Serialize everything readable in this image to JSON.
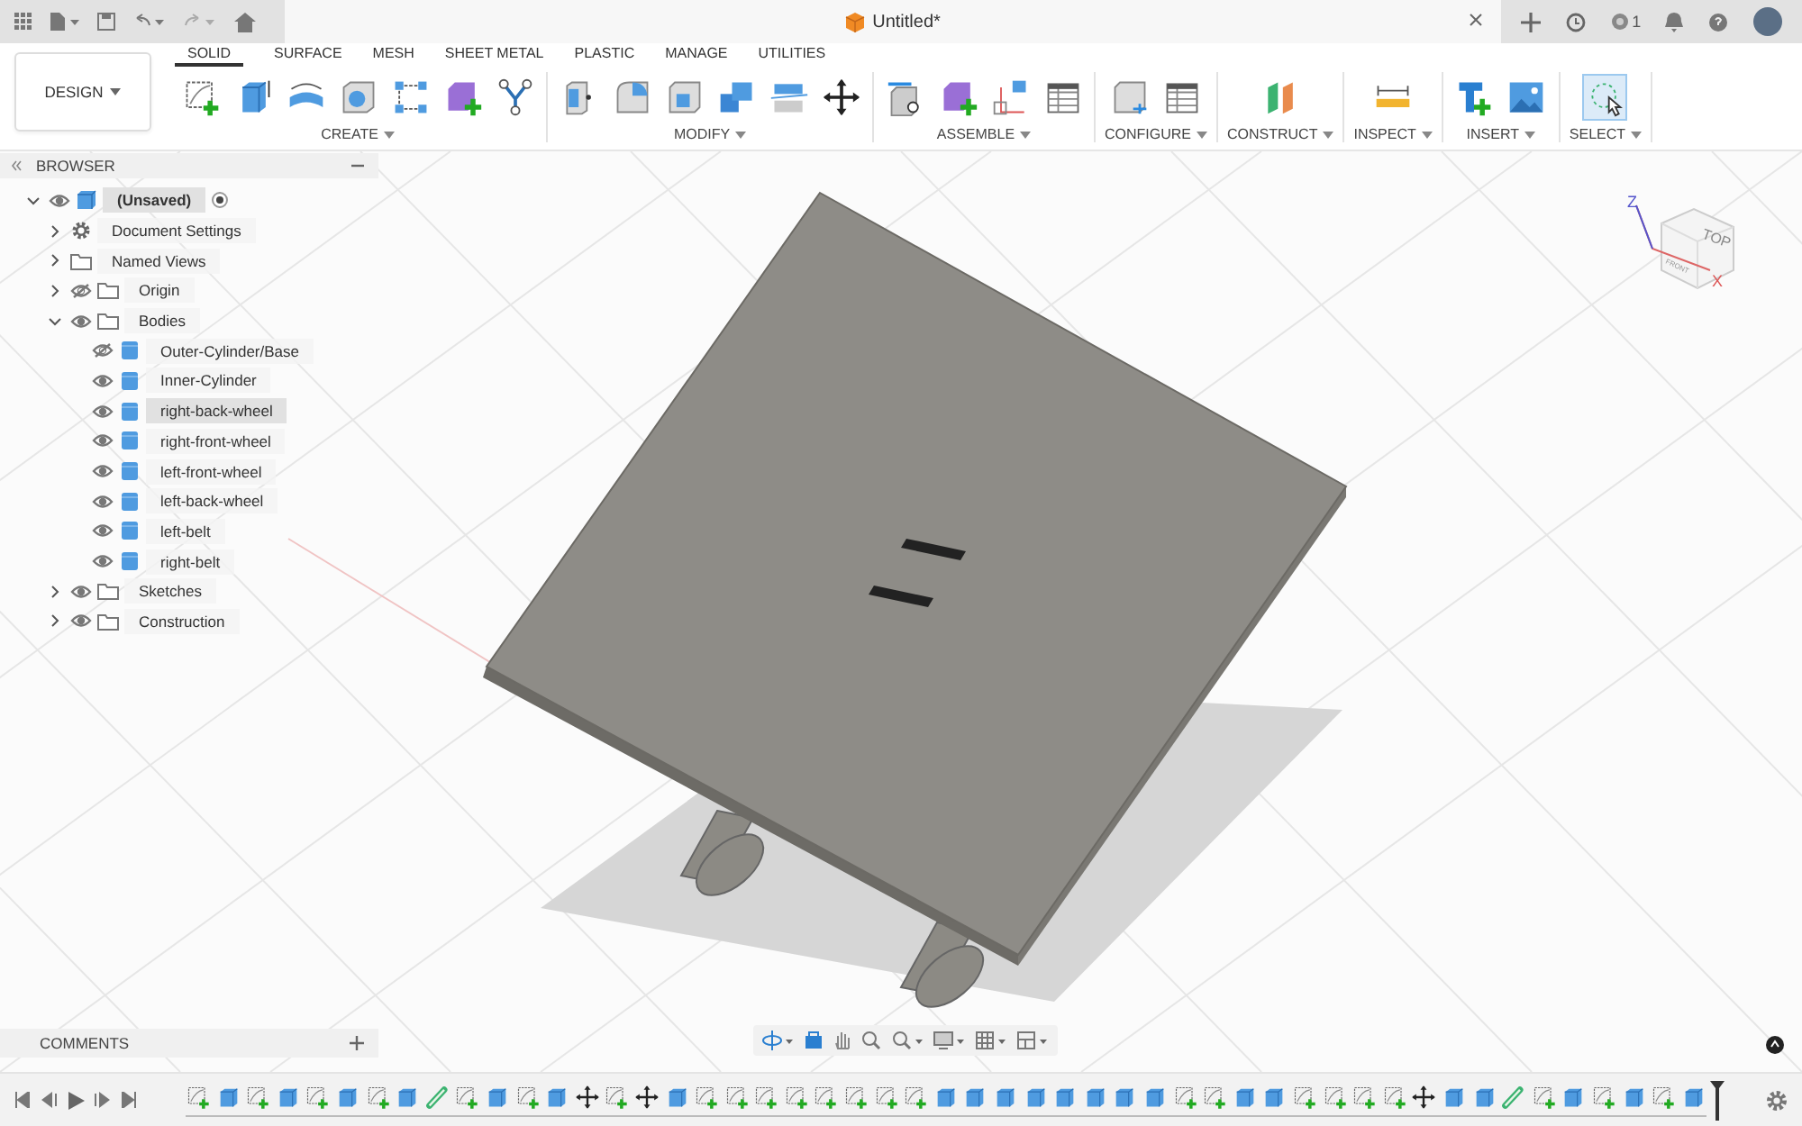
{
  "top_bar": {
    "document_tab": {
      "title": "Untitled*"
    },
    "job_count": "1"
  },
  "ribbon": {
    "workspace": "DESIGN",
    "tabs": [
      {
        "label": "SOLID",
        "selected": true
      },
      {
        "label": "SURFACE",
        "selected": false
      },
      {
        "label": "MESH",
        "selected": false
      },
      {
        "label": "SHEET METAL",
        "selected": false
      },
      {
        "label": "PLASTIC",
        "selected": false
      },
      {
        "label": "MANAGE",
        "selected": false
      },
      {
        "label": "UTILITIES",
        "selected": false
      }
    ],
    "groups": [
      {
        "label": "CREATE",
        "tools": [
          {
            "kind": "sketch"
          },
          {
            "kind": "extrude"
          },
          {
            "kind": "revolve"
          },
          {
            "kind": "hole"
          },
          {
            "kind": "pattern"
          },
          {
            "kind": "component"
          },
          {
            "kind": "fork"
          }
        ]
      },
      {
        "label": "MODIFY",
        "tools": [
          {
            "kind": "press-pull"
          },
          {
            "kind": "fillet"
          },
          {
            "kind": "shell"
          },
          {
            "kind": "combine"
          },
          {
            "kind": "split"
          },
          {
            "kind": "move"
          }
        ]
      },
      {
        "label": "ASSEMBLE",
        "tools": [
          {
            "kind": "joint"
          },
          {
            "kind": "component"
          },
          {
            "kind": "joint-origin"
          },
          {
            "kind": "table"
          }
        ]
      },
      {
        "label": "CONFIGURE",
        "tools": [
          {
            "kind": "config-cube"
          },
          {
            "kind": "table"
          }
        ]
      },
      {
        "label": "CONSTRUCT",
        "tools": [
          {
            "kind": "planes"
          }
        ]
      },
      {
        "label": "INSPECT",
        "tools": [
          {
            "kind": "measure"
          }
        ]
      },
      {
        "label": "INSERT",
        "tools": [
          {
            "kind": "insert"
          },
          {
            "kind": "image"
          }
        ]
      },
      {
        "label": "SELECT",
        "tools": [
          {
            "kind": "select"
          }
        ]
      }
    ]
  },
  "browser": {
    "title": "BROWSER",
    "tree": [
      {
        "label": "(Unsaved)",
        "kind": "component",
        "visible": true,
        "expanded": true,
        "selected": true,
        "active": true,
        "children": [
          {
            "label": "Document Settings",
            "kind": "settings",
            "expanded": false,
            "selected": false
          },
          {
            "label": "Named Views",
            "kind": "folder",
            "expanded": false,
            "selected": false
          },
          {
            "label": "Origin",
            "kind": "folder",
            "visible": false,
            "expanded": false,
            "selected": false
          },
          {
            "label": "Bodies",
            "kind": "folder",
            "visible": true,
            "expanded": true,
            "selected": false,
            "children": [
              {
                "label": "Outer-Cylinder/Base",
                "kind": "body",
                "visible": false,
                "selected": false
              },
              {
                "label": "Inner-Cylinder",
                "kind": "body",
                "visible": true,
                "selected": false
              },
              {
                "label": "right-back-wheel",
                "kind": "body",
                "visible": true,
                "selected": true
              },
              {
                "label": "right-front-wheel",
                "kind": "body",
                "visible": true,
                "selected": false
              },
              {
                "label": "left-front-wheel",
                "kind": "body",
                "visible": true,
                "selected": false
              },
              {
                "label": "left-back-wheel",
                "kind": "body",
                "visible": true,
                "selected": false
              },
              {
                "label": "left-belt",
                "kind": "body",
                "visible": true,
                "selected": false
              },
              {
                "label": "right-belt",
                "kind": "body",
                "visible": true,
                "selected": false
              }
            ]
          },
          {
            "label": "Sketches",
            "kind": "folder",
            "visible": true,
            "expanded": false,
            "selected": false
          },
          {
            "label": "Construction",
            "kind": "folder",
            "visible": true,
            "expanded": false,
            "selected": false
          }
        ]
      }
    ]
  },
  "view_cube": {
    "top": "TOP",
    "front": "FRONT",
    "axis_z": "Z",
    "axis_x": "X"
  },
  "comments": {
    "title": "COMMENTS"
  },
  "timeline": {
    "features": [
      {
        "kind": "sketch"
      },
      {
        "kind": "body"
      },
      {
        "kind": "sketch"
      },
      {
        "kind": "body"
      },
      {
        "kind": "sketch"
      },
      {
        "kind": "body"
      },
      {
        "kind": "sketch"
      },
      {
        "kind": "body"
      },
      {
        "kind": "pipe"
      },
      {
        "kind": "sketch"
      },
      {
        "kind": "body"
      },
      {
        "kind": "sketch"
      },
      {
        "kind": "body"
      },
      {
        "kind": "move"
      },
      {
        "kind": "sketch"
      },
      {
        "kind": "move"
      },
      {
        "kind": "body"
      },
      {
        "kind": "sketch"
      },
      {
        "kind": "sketch"
      },
      {
        "kind": "sketch"
      },
      {
        "kind": "sketch"
      },
      {
        "kind": "sketch"
      },
      {
        "kind": "sketch"
      },
      {
        "kind": "sketch"
      },
      {
        "kind": "sketch"
      },
      {
        "kind": "body"
      },
      {
        "kind": "body"
      },
      {
        "kind": "body"
      },
      {
        "kind": "body"
      },
      {
        "kind": "body"
      },
      {
        "kind": "body"
      },
      {
        "kind": "body"
      },
      {
        "kind": "body"
      },
      {
        "kind": "sketch"
      },
      {
        "kind": "sketch"
      },
      {
        "kind": "body"
      },
      {
        "kind": "body"
      },
      {
        "kind": "sketch"
      },
      {
        "kind": "sketch"
      },
      {
        "kind": "sketch"
      },
      {
        "kind": "sketch"
      },
      {
        "kind": "move"
      },
      {
        "kind": "body"
      },
      {
        "kind": "body"
      },
      {
        "kind": "pipe"
      },
      {
        "kind": "sketch"
      },
      {
        "kind": "body"
      },
      {
        "kind": "sketch"
      },
      {
        "kind": "body"
      },
      {
        "kind": "sketch"
      },
      {
        "kind": "body"
      }
    ]
  }
}
